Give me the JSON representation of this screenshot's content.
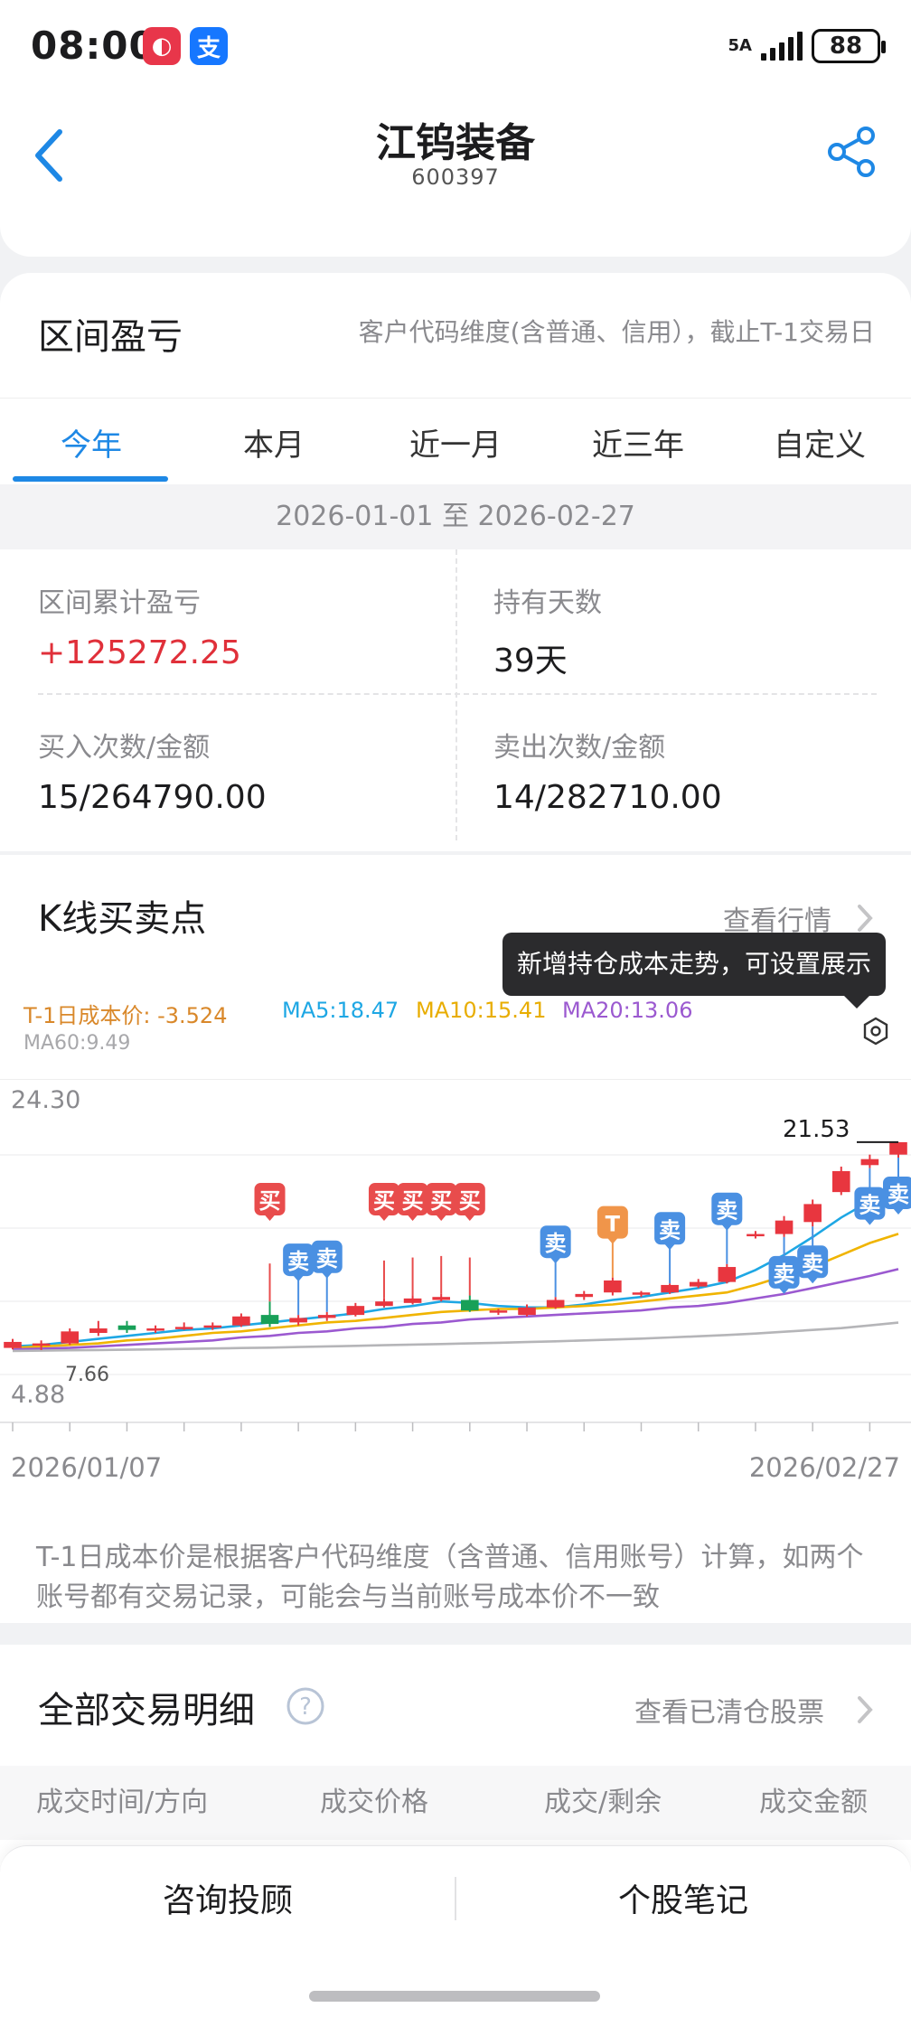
{
  "status_bar": {
    "time": "08:00",
    "network": "5A",
    "battery": "88",
    "app_icons": [
      "camera-app-icon",
      "alipay-app-icon"
    ]
  },
  "header": {
    "title": "江钨装备",
    "code": "600397",
    "back_icon": "chevron-left-icon",
    "share_icon": "share-icon"
  },
  "profit": {
    "title": "区间盈亏",
    "note": "客户代码维度(含普通、信用），截止T-1交易日",
    "tabs": [
      {
        "label": "今年",
        "active": true
      },
      {
        "label": "本月",
        "active": false
      },
      {
        "label": "近一月",
        "active": false
      },
      {
        "label": "近三年",
        "active": false
      },
      {
        "label": "自定义",
        "active": false
      }
    ],
    "date_range": "2026-01-01 至 2026-02-27",
    "stats": {
      "cum_label": "区间累计盈亏",
      "cum_value": "+125272.25",
      "days_label": "持有天数",
      "days_value": "39天",
      "buy_label": "买入次数/金额",
      "buy_value": "15/264790.00",
      "sell_label": "卖出次数/金额",
      "sell_value": "14/282710.00"
    }
  },
  "kline": {
    "title": "K线买卖点",
    "view_market": "查看行情",
    "tooltip": "新增持仓成本走势，可设置展示",
    "ma": {
      "cost": "T-1日成本价: -3.524",
      "ma5": "MA5:18.47",
      "ma10": "MA10:15.41",
      "ma20": "MA20:13.06",
      "ma60": "MA60:9.49"
    },
    "footnote": "T-1日成本价是根据客户代码维度（含普通、信用账号）计算，如两个账号都有交易记录，可能会与当前账号成本价不一致",
    "colors": {
      "up": "#e8363f",
      "down": "#18a058",
      "cost": "#d9882a",
      "ma5": "#1ea7e4",
      "ma10": "#f0b400",
      "ma20": "#9b59d0",
      "ma60": "#b5b5b8",
      "buy": "#e84c4c",
      "sell": "#4a90e2",
      "t": "#f0954a"
    }
  },
  "chart_data": {
    "type": "candlestick",
    "ylim": [
      4.88,
      24.3
    ],
    "y_high_label": "24.30",
    "y_low_label": "4.88",
    "x_start_label": "2026/01/07",
    "x_end_label": "2026/02/27",
    "max_label": "21.53",
    "min_label": "7.66",
    "candles": [
      {
        "o": 7.8,
        "c": 8.2,
        "h": 8.4,
        "l": 7.7
      },
      {
        "o": 8.0,
        "c": 8.1,
        "h": 8.3,
        "l": 7.66
      },
      {
        "o": 8.1,
        "c": 8.9,
        "h": 9.1,
        "l": 8.0
      },
      {
        "o": 8.8,
        "c": 9.1,
        "h": 9.6,
        "l": 8.6
      },
      {
        "o": 9.3,
        "c": 9.0,
        "h": 9.6,
        "l": 8.8
      },
      {
        "o": 9.0,
        "c": 9.1,
        "h": 9.3,
        "l": 8.8
      },
      {
        "o": 9.1,
        "c": 9.2,
        "h": 9.5,
        "l": 9.0
      },
      {
        "o": 9.2,
        "c": 9.3,
        "h": 9.5,
        "l": 9.0
      },
      {
        "o": 9.3,
        "c": 9.9,
        "h": 10.1,
        "l": 9.2
      },
      {
        "o": 10.0,
        "c": 9.4,
        "h": 10.9,
        "l": 9.2
      },
      {
        "o": 9.5,
        "c": 9.8,
        "h": 10.0,
        "l": 9.3
      },
      {
        "o": 9.8,
        "c": 10.0,
        "h": 10.2,
        "l": 9.6
      },
      {
        "o": 10.0,
        "c": 10.6,
        "h": 10.8,
        "l": 9.9
      },
      {
        "o": 10.6,
        "c": 10.9,
        "h": 11.1,
        "l": 10.5
      },
      {
        "o": 10.8,
        "c": 11.1,
        "h": 11.3,
        "l": 10.7
      },
      {
        "o": 11.0,
        "c": 11.2,
        "h": 11.4,
        "l": 10.9
      },
      {
        "o": 11.0,
        "c": 10.3,
        "h": 11.3,
        "l": 10.2
      },
      {
        "o": 10.2,
        "c": 10.3,
        "h": 10.4,
        "l": 10.0
      },
      {
        "o": 10.0,
        "c": 10.5,
        "h": 10.7,
        "l": 9.9
      },
      {
        "o": 10.5,
        "c": 11.0,
        "h": 11.2,
        "l": 10.4
      },
      {
        "o": 11.2,
        "c": 11.4,
        "h": 11.6,
        "l": 11.0
      },
      {
        "o": 11.5,
        "c": 12.3,
        "h": 12.5,
        "l": 11.3
      },
      {
        "o": 11.4,
        "c": 11.5,
        "h": 11.6,
        "l": 11.2
      },
      {
        "o": 11.5,
        "c": 12.0,
        "h": 12.1,
        "l": 11.4
      },
      {
        "o": 11.9,
        "c": 12.2,
        "h": 12.4,
        "l": 11.8
      },
      {
        "o": 12.2,
        "c": 13.2,
        "h": 13.4,
        "l": 12.1
      },
      {
        "o": 15.3,
        "c": 15.4,
        "h": 15.6,
        "l": 15.1
      },
      {
        "o": 15.4,
        "c": 16.3,
        "h": 16.6,
        "l": 15.2
      },
      {
        "o": 16.2,
        "c": 17.4,
        "h": 17.7,
        "l": 15.9
      },
      {
        "o": 18.2,
        "c": 19.6,
        "h": 19.9,
        "l": 18.0
      },
      {
        "o": 20.0,
        "c": 20.4,
        "h": 20.7,
        "l": 19.8
      },
      {
        "o": 20.7,
        "c": 21.53,
        "h": 21.53,
        "l": 20.5
      }
    ],
    "series": [
      {
        "name": "MA5",
        "values": [
          7.9,
          8.0,
          8.2,
          8.4,
          8.6,
          8.8,
          9.0,
          9.1,
          9.3,
          9.5,
          9.7,
          9.9,
          10.1,
          10.4,
          10.6,
          10.9,
          10.8,
          10.6,
          10.5,
          10.5,
          10.7,
          11.0,
          11.2,
          11.5,
          11.8,
          12.2,
          13.0,
          14.0,
          15.2,
          16.5,
          17.6,
          18.47
        ]
      },
      {
        "name": "MA10",
        "values": [
          7.8,
          7.9,
          8.0,
          8.1,
          8.3,
          8.4,
          8.6,
          8.8,
          8.9,
          9.1,
          9.3,
          9.5,
          9.6,
          9.8,
          10.0,
          10.2,
          10.3,
          10.4,
          10.4,
          10.5,
          10.6,
          10.7,
          10.9,
          11.1,
          11.3,
          11.5,
          12.0,
          12.6,
          13.2,
          14.0,
          14.8,
          15.41
        ]
      },
      {
        "name": "MA20",
        "values": [
          7.7,
          7.75,
          7.8,
          7.9,
          8.0,
          8.1,
          8.2,
          8.3,
          8.5,
          8.6,
          8.8,
          8.9,
          9.1,
          9.2,
          9.4,
          9.5,
          9.7,
          9.8,
          9.9,
          10.0,
          10.1,
          10.2,
          10.3,
          10.5,
          10.6,
          10.8,
          11.1,
          11.4,
          11.8,
          12.2,
          12.6,
          13.06
        ]
      },
      {
        "name": "MA60",
        "values": [
          7.6,
          7.62,
          7.64,
          7.66,
          7.68,
          7.7,
          7.73,
          7.76,
          7.79,
          7.82,
          7.86,
          7.9,
          7.94,
          7.98,
          8.02,
          8.06,
          8.1,
          8.14,
          8.19,
          8.24,
          8.3,
          8.36,
          8.42,
          8.5,
          8.58,
          8.66,
          8.76,
          8.88,
          9.0,
          9.12,
          9.3,
          9.49
        ]
      }
    ],
    "markers": [
      {
        "i": 9,
        "label": "买",
        "kind": "buy",
        "pos": "above"
      },
      {
        "i": 10,
        "label": "卖",
        "kind": "sell",
        "pos": "above"
      },
      {
        "i": 11,
        "label": "卖",
        "kind": "sell",
        "pos": "above"
      },
      {
        "i": 13,
        "label": "买",
        "kind": "buy",
        "pos": "above"
      },
      {
        "i": 14,
        "label": "买",
        "kind": "buy",
        "pos": "above"
      },
      {
        "i": 15,
        "label": "买",
        "kind": "buy",
        "pos": "above"
      },
      {
        "i": 16,
        "label": "买",
        "kind": "buy",
        "pos": "above"
      },
      {
        "i": 19,
        "label": "卖",
        "kind": "sell",
        "pos": "above"
      },
      {
        "i": 21,
        "label": "T",
        "kind": "t",
        "pos": "above"
      },
      {
        "i": 23,
        "label": "卖",
        "kind": "sell",
        "pos": "above"
      },
      {
        "i": 25,
        "label": "卖",
        "kind": "sell",
        "pos": "above"
      },
      {
        "i": 27,
        "label": "卖",
        "kind": "sell",
        "pos": "below"
      },
      {
        "i": 28,
        "label": "卖",
        "kind": "sell",
        "pos": "below"
      },
      {
        "i": 30,
        "label": "卖",
        "kind": "sell",
        "pos": "below"
      },
      {
        "i": 31,
        "label": "卖",
        "kind": "sell",
        "pos": "below"
      }
    ]
  },
  "trades": {
    "title": "全部交易明细",
    "view_cleared": "查看已清仓股票",
    "columns": [
      "成交时间/方向",
      "成交价格",
      "成交/剩余",
      "成交金额"
    ]
  },
  "bottom_bar": {
    "consult": "咨询投顾",
    "notes": "个股笔记"
  }
}
